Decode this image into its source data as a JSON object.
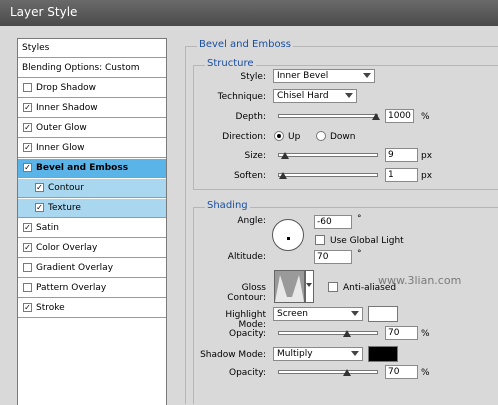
{
  "window": {
    "title": "Layer Style"
  },
  "sidebar": {
    "header": "Styles",
    "blending": "Blending Options: Custom",
    "items": [
      {
        "label": "Drop Shadow",
        "checked": false
      },
      {
        "label": "Inner Shadow",
        "checked": true
      },
      {
        "label": "Outer Glow",
        "checked": true
      },
      {
        "label": "Inner Glow",
        "checked": true
      },
      {
        "label": "Bevel and Emboss",
        "checked": true
      },
      {
        "label": "Contour",
        "checked": true
      },
      {
        "label": "Texture",
        "checked": true
      },
      {
        "label": "Satin",
        "checked": true
      },
      {
        "label": "Color Overlay",
        "checked": true
      },
      {
        "label": "Gradient Overlay",
        "checked": false
      },
      {
        "label": "Pattern Overlay",
        "checked": false
      },
      {
        "label": "Stroke",
        "checked": true
      }
    ]
  },
  "bevel": {
    "title": "Bevel and Emboss",
    "structure": {
      "title": "Structure",
      "style_label": "Style:",
      "style_value": "Inner Bevel",
      "technique_label": "Technique:",
      "technique_value": "Chisel Hard",
      "depth_label": "Depth:",
      "depth_value": "1000",
      "depth_unit": "%",
      "direction_label": "Direction:",
      "dir_up": "Up",
      "dir_down": "Down",
      "size_label": "Size:",
      "size_value": "9",
      "size_unit": "px",
      "soften_label": "Soften:",
      "soften_value": "1",
      "soften_unit": "px"
    },
    "shading": {
      "title": "Shading",
      "angle_label": "Angle:",
      "angle_value": "-60",
      "angle_unit": "°",
      "global_light": "Use Global Light",
      "altitude_label": "Altitude:",
      "altitude_value": "70",
      "altitude_unit": "°",
      "gloss_label": "Gloss Contour:",
      "antialiased": "Anti-aliased",
      "highlight_label": "Highlight Mode:",
      "highlight_value": "Screen",
      "highlight_color": "#ffffff",
      "opacity_label": "Opacity:",
      "hl_opacity_value": "70",
      "opacity_unit": "%",
      "shadow_label": "Shadow Mode:",
      "shadow_value": "Multiply",
      "shadow_color": "#000000",
      "sh_opacity_value": "70"
    }
  },
  "watermark": {
    "site": "www.3lian.com"
  }
}
